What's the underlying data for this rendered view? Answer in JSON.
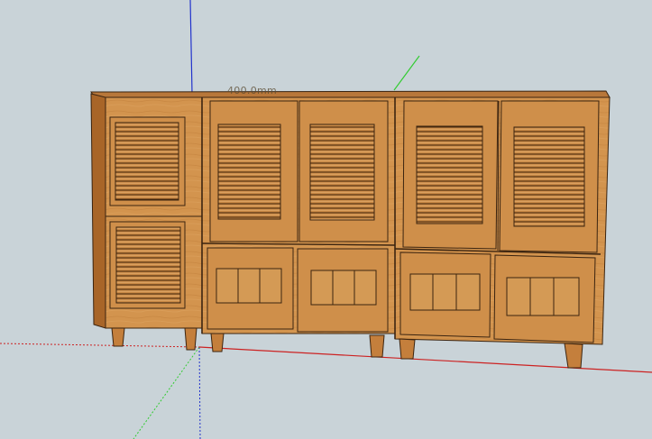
{
  "viewport": {
    "background": "#c9d3d8",
    "dimension_label": "400.0mm"
  },
  "axes": {
    "blue": "#2233cc",
    "green": "#33cc33",
    "red": "#cc2222"
  },
  "model": {
    "wood_light": "#d99a52",
    "wood_mid": "#c47f3c",
    "wood_dark": "#a86528",
    "outline": "#3b2410",
    "slat_line": "#7a4a1f",
    "cabinets": [
      {
        "name": "single-tall-cabinet",
        "doors": 2,
        "door_style": "louvered"
      },
      {
        "name": "middle-cabinet",
        "upper_doors": 2,
        "upper_style": "louvered",
        "lower_doors": 2,
        "lower_style": "panel"
      },
      {
        "name": "right-cabinet",
        "upper_doors": 2,
        "upper_style": "louvered",
        "lower_doors": 2,
        "lower_style": "panel"
      }
    ]
  }
}
